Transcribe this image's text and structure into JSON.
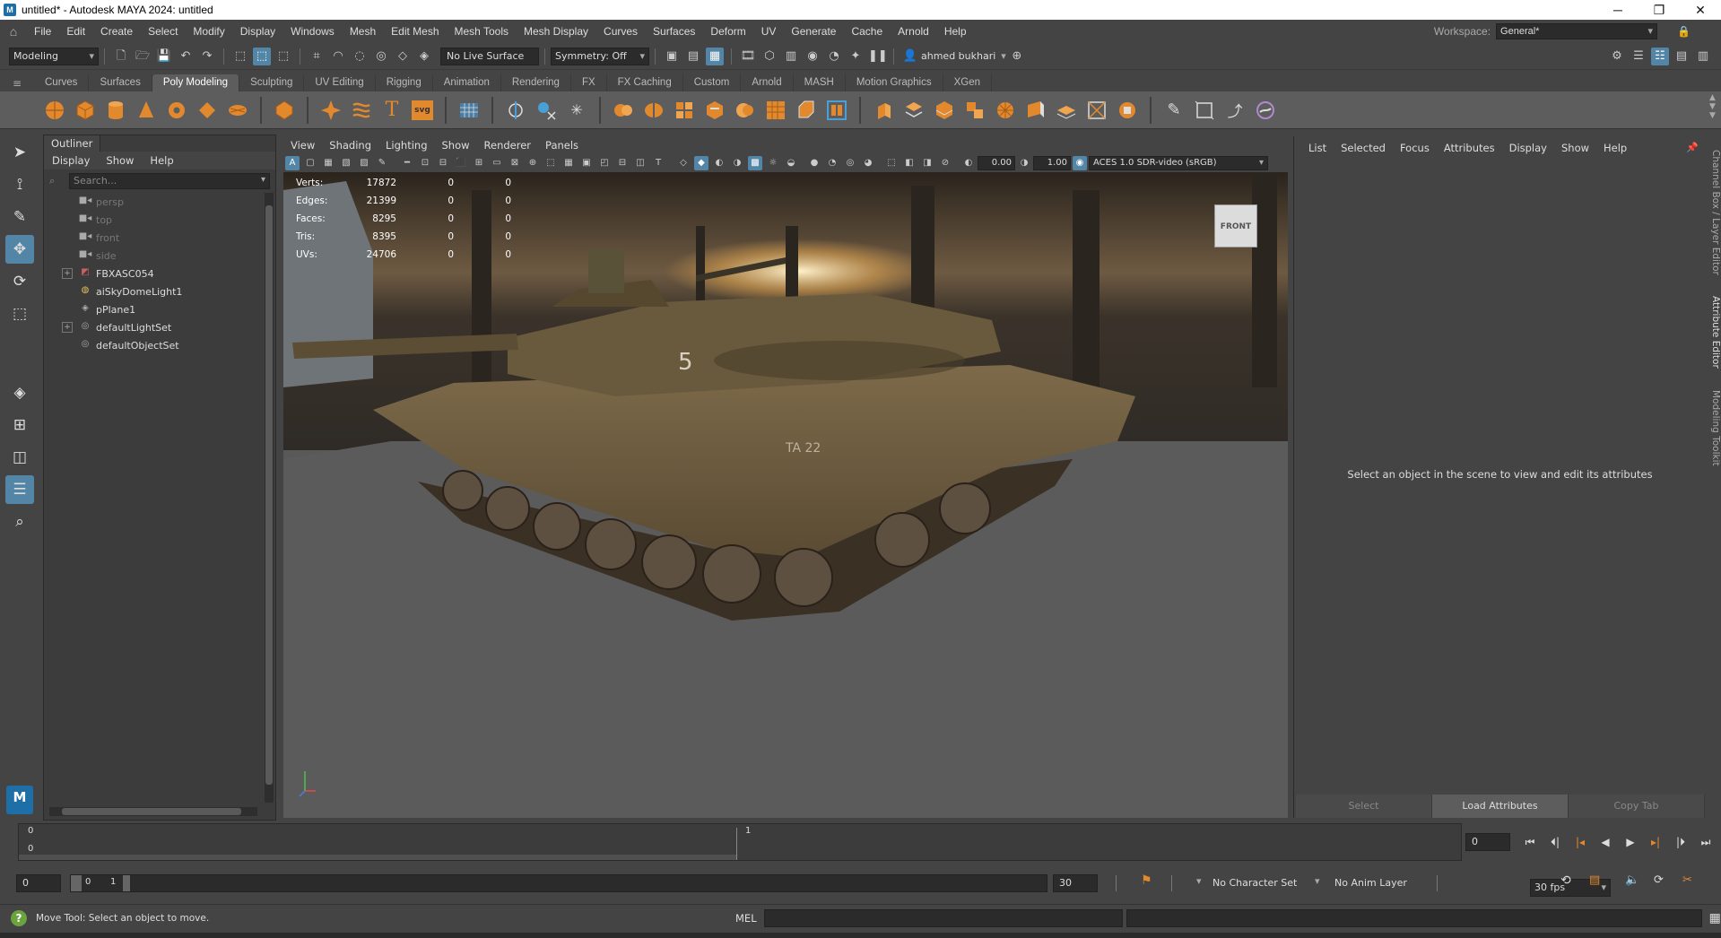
{
  "titlebar": {
    "title": "untitled* - Autodesk MAYA 2024: untitled",
    "app_icon": "M",
    "minimize": "─",
    "maximize": "❐",
    "close": "✕"
  },
  "menubar": {
    "items": [
      "File",
      "Edit",
      "Create",
      "Select",
      "Modify",
      "Display",
      "Windows",
      "Mesh",
      "Edit Mesh",
      "Mesh Tools",
      "Mesh Display",
      "Curves",
      "Surfaces",
      "Deform",
      "UV",
      "Generate",
      "Cache",
      "Arnold",
      "Help"
    ],
    "workspace_label": "Workspace:",
    "workspace_value": "General*"
  },
  "statusline": {
    "menu_set": "Modeling",
    "live_surface": "No Live Surface",
    "symmetry": "Symmetry: Off",
    "user": "ahmed bukhari"
  },
  "shelf_tabs": [
    "Curves",
    "Surfaces",
    "Poly Modeling",
    "Sculpting",
    "UV Editing",
    "Rigging",
    "Animation",
    "Rendering",
    "FX",
    "FX Caching",
    "Custom",
    "Arnold",
    "MASH",
    "Motion Graphics",
    "XGen"
  ],
  "shelf_active": "Poly Modeling",
  "shelf_svg_label": "svg",
  "shelf_text_label": "T",
  "outliner": {
    "tab": "Outliner",
    "menu": [
      "Display",
      "Show",
      "Help"
    ],
    "search_placeholder": "Search...",
    "items": [
      {
        "label": "persp",
        "type": "camera",
        "dim": true,
        "expandable": false
      },
      {
        "label": "top",
        "type": "camera",
        "dim": true,
        "expandable": false
      },
      {
        "label": "front",
        "type": "camera",
        "dim": true,
        "expandable": false
      },
      {
        "label": "side",
        "type": "camera",
        "dim": true,
        "expandable": false
      },
      {
        "label": "FBXASC054",
        "type": "mesh",
        "dim": false,
        "expandable": true
      },
      {
        "label": "aiSkyDomeLight1",
        "type": "light",
        "dim": false,
        "expandable": false
      },
      {
        "label": "pPlane1",
        "type": "plane",
        "dim": false,
        "expandable": false
      },
      {
        "label": "defaultLightSet",
        "type": "set",
        "dim": false,
        "expandable": true
      },
      {
        "label": "defaultObjectSet",
        "type": "set",
        "dim": false,
        "expandable": false
      }
    ]
  },
  "viewport": {
    "menu": [
      "View",
      "Shading",
      "Lighting",
      "Show",
      "Renderer",
      "Panels"
    ],
    "exposure": "0.00",
    "gamma": "1.00",
    "color_space": "ACES 1.0 SDR-video (sRGB)",
    "view_cube": "FRONT",
    "hud": [
      {
        "label": "Verts:",
        "value": "17872",
        "a": "0",
        "b": "0"
      },
      {
        "label": "Edges:",
        "value": "21399",
        "a": "0",
        "b": "0"
      },
      {
        "label": "Faces:",
        "value": "8295",
        "a": "0",
        "b": "0"
      },
      {
        "label": "Tris:",
        "value": "8395",
        "a": "0",
        "b": "0"
      },
      {
        "label": "UVs:",
        "value": "24706",
        "a": "0",
        "b": "0"
      }
    ],
    "tank_number": "5",
    "tank_marking": "TA 22"
  },
  "attribute_editor": {
    "menu": [
      "List",
      "Selected",
      "Focus",
      "Attributes",
      "Display",
      "Show",
      "Help"
    ],
    "message": "Select an object in the scene to view and edit its attributes",
    "buttons": [
      "Select",
      "Load Attributes",
      "Copy Tab"
    ]
  },
  "side_tabs": [
    "Channel Box / Layer Editor",
    "Attribute Editor",
    "Modeling Toolkit"
  ],
  "timeline": {
    "start_tick": "0",
    "mid_tick": "1",
    "current_frame": "0",
    "left_value": "0"
  },
  "range": {
    "start": "0",
    "inner_start": "0",
    "inner_end": "1",
    "end": "30",
    "character_set": "No Character Set",
    "anim_layer": "No Anim Layer",
    "fps": "30 fps"
  },
  "help_line": {
    "text": "Move Tool: Select an object to move.",
    "mel_label": "MEL"
  },
  "colors": {
    "accent": "#5285a6",
    "background": "#444444",
    "panel": "#3c3c3c",
    "shelf": "#5d5d5d"
  }
}
